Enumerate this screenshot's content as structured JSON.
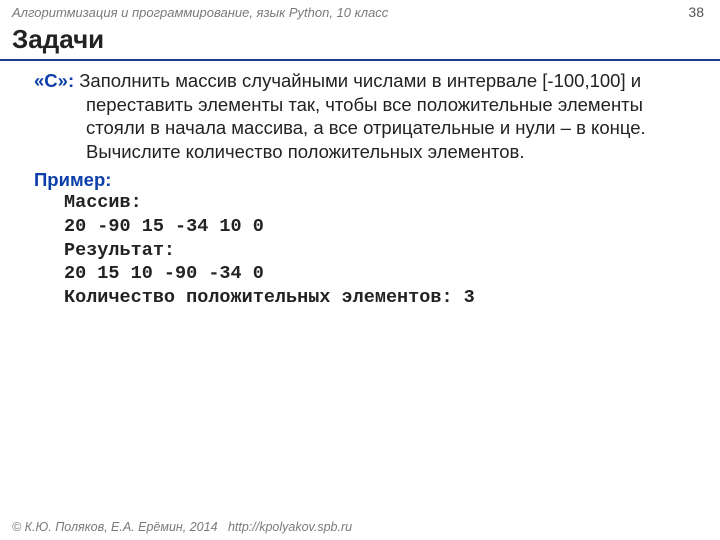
{
  "header": {
    "course": "Алгоритмизация и программирование, язык Python, 10 класс",
    "page": "38"
  },
  "title": "Задачи",
  "task": {
    "label": "«С»:",
    "text": " Заполнить массив случайными числами в интервале [-100,100] и переставить элементы так, чтобы все положительные элементы стояли в начала массива, а все отрицательные и нули – в конце.  Вычислите количество положительных элементов."
  },
  "example": {
    "label": "Пример:",
    "lines": [
      "Массив:",
      "20 -90 15 -34 10 0",
      "Результат:",
      "20 15 10 -90 -34 0",
      "Количество положительных элементов: 3"
    ]
  },
  "footer": {
    "copyright": "© К.Ю. Поляков, Е.А. Ерёмин, 2014",
    "url": "http://kpolyakov.spb.ru"
  }
}
